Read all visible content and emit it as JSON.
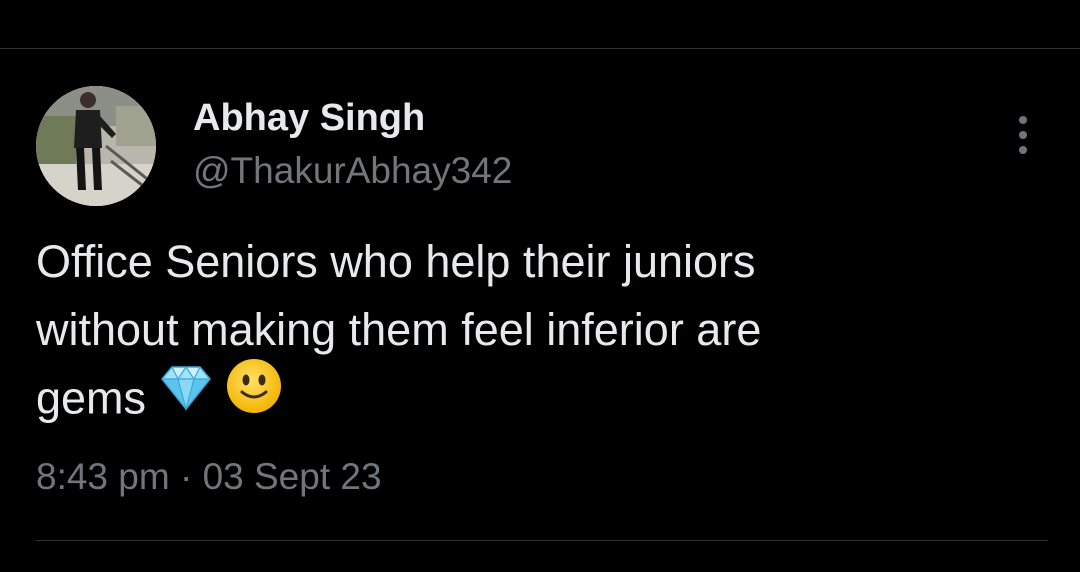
{
  "tweet": {
    "author": {
      "display_name": "Abhay Singh",
      "handle": "@ThakurAbhay342",
      "avatar_icon": "profile-photo-avatar"
    },
    "more_icon": "more-vertical-icon",
    "text_lines": [
      "Office Seniors who help their juniors",
      "without making them feel inferior are",
      "gems"
    ],
    "emojis": [
      "gem-stone-emoji",
      "slightly-smiling-face-emoji"
    ],
    "timestamp": "8:43 pm · 03 Sept 23"
  },
  "colors": {
    "background": "#000000",
    "primary_text": "#e7e9ea",
    "secondary_text": "#71767b",
    "divider": "#2f3336"
  }
}
